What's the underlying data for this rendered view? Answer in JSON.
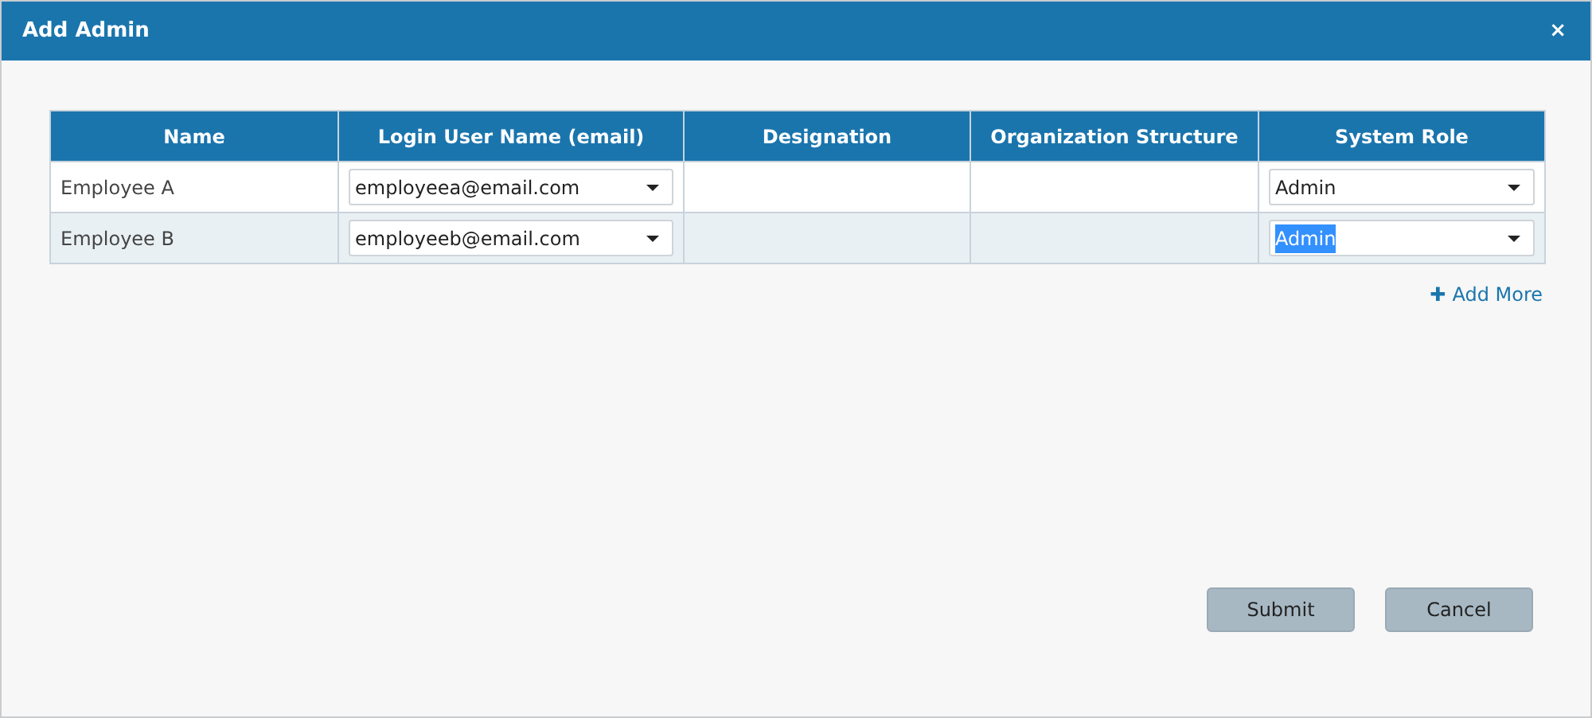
{
  "window": {
    "title": "Add Admin",
    "close": "×"
  },
  "table": {
    "columns": [
      "Name",
      "Login User Name (email)",
      "Designation",
      "Organization Structure",
      "System Role"
    ],
    "rows": [
      {
        "name": "Employee A",
        "email": {
          "value": "employeea@email.com"
        },
        "system_role": {
          "value": "Admin",
          "text_selected": false
        }
      },
      {
        "name": "Employee B",
        "email": {
          "value": "employeeb@email.com"
        },
        "system_role": {
          "value": "Admin",
          "text_selected": true
        }
      }
    ]
  },
  "add_more": {
    "icon": "✚",
    "label": "Add More"
  },
  "buttons": [
    "Submit",
    "Cancel"
  ]
}
